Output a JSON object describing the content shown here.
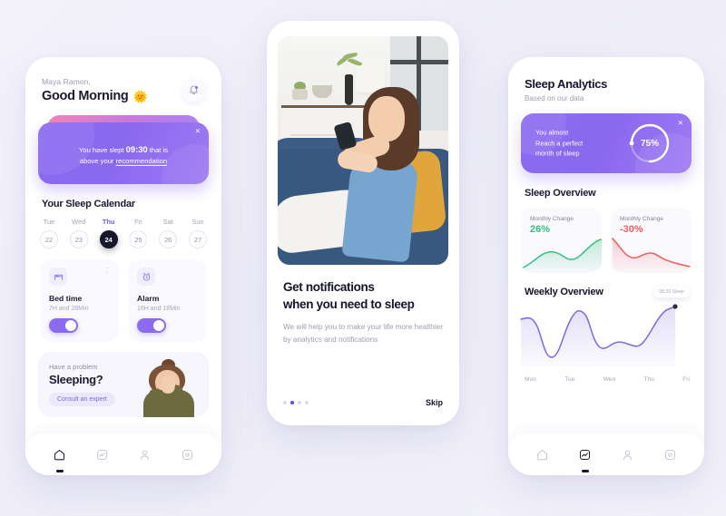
{
  "canvas": {
    "background": "#f1f0fa"
  },
  "phone1": {
    "header": {
      "name": "Maya Ramon,",
      "greeting": "Good Morning",
      "emoji": "🌞",
      "bell_icon": "bell-icon"
    },
    "banner": {
      "close": "✕",
      "prefix": "You have slept ",
      "time": "09:30",
      "middle": " that is",
      "line2_prefix": "above your ",
      "link": "recommendation",
      "gradient_from": "#8d6bf0",
      "gradient_to": "#9d7af3"
    },
    "calendar": {
      "title": "Your Sleep Calendar",
      "days": [
        {
          "day": "Tue",
          "num": "22",
          "active": false
        },
        {
          "day": "Wed",
          "num": "23",
          "active": false
        },
        {
          "day": "Thu",
          "num": "24",
          "active": true
        },
        {
          "day": "Fri",
          "num": "25",
          "active": false
        },
        {
          "day": "Sat",
          "num": "26",
          "active": false
        },
        {
          "day": "Sun",
          "num": "27",
          "active": false
        }
      ]
    },
    "settings": [
      {
        "icon": "bed-icon",
        "name": "Bed time",
        "value": "7H and 28Min",
        "toggle_on": true,
        "menu": "⋮"
      },
      {
        "icon": "alarm-clock-icon",
        "name": "Alarm",
        "value": "16H and 18Min",
        "toggle_on": true,
        "menu": ""
      }
    ],
    "promo": {
      "small": "Have a problem",
      "big": "Sleeping?",
      "button": "Consult an expert"
    },
    "tabs": [
      {
        "icon": "home-icon",
        "active": true
      },
      {
        "icon": "analytics-icon",
        "active": false
      },
      {
        "icon": "profile-icon",
        "active": false
      },
      {
        "icon": "settings-gear-icon",
        "active": false
      }
    ]
  },
  "phone2": {
    "hero_alt": "woman-on-sofa-with-phone-photo",
    "title_line1": "Get notifications",
    "title_line2": "when you need to sleep",
    "subtitle": "We will help you to make your life more healthier by analytics and notifications",
    "dots": [
      false,
      true,
      false,
      false
    ],
    "skip": "Skip"
  },
  "phone3": {
    "title": "Sleep Analytics",
    "subtitle": "Based on our data",
    "analytics_card": {
      "close": "✕",
      "line1": "You almost",
      "line2": "Reach a perfect",
      "line3": "month of sleep",
      "percent": "75%",
      "percent_value": 75
    },
    "overview_title": "Sleep Overview",
    "overview_cards": [
      {
        "label": "Monthly Change",
        "value": "26%",
        "color": "#35c17f",
        "trend": "up"
      },
      {
        "label": "Monthly Change",
        "value": "-30%",
        "color": "#ef5d5d",
        "trend": "down"
      }
    ],
    "weekly": {
      "title": "Weekly Overview",
      "tooltip": "08:20 Sleep",
      "axis": [
        "Mon",
        "Tue",
        "Wed",
        "Thu",
        "Fri"
      ],
      "line_color": "#7b6ae0"
    },
    "tabs": [
      {
        "icon": "home-icon",
        "active": false
      },
      {
        "icon": "analytics-icon",
        "active": true
      },
      {
        "icon": "profile-icon",
        "active": false
      },
      {
        "icon": "settings-gear-icon",
        "active": false
      }
    ]
  },
  "chart_data": [
    {
      "type": "area",
      "title": "Monthly Change",
      "series_name": "positive-trend",
      "color": "#35c17f",
      "label": "26%",
      "x": [
        0,
        1,
        2,
        3,
        4,
        5,
        6,
        7,
        8
      ],
      "values": [
        12,
        22,
        30,
        44,
        40,
        33,
        38,
        52,
        66
      ]
    },
    {
      "type": "area",
      "title": "Monthly Change",
      "series_name": "negative-trend",
      "color": "#ef5d5d",
      "label": "-30%",
      "x": [
        0,
        1,
        2,
        3,
        4,
        5,
        6,
        7,
        8
      ],
      "values": [
        66,
        48,
        33,
        30,
        38,
        36,
        26,
        16,
        11
      ]
    },
    {
      "type": "area",
      "title": "Weekly Overview",
      "categories": [
        "Mon",
        "Tue",
        "Wed",
        "Thu",
        "Fri"
      ],
      "x": [
        0,
        0.5,
        1,
        1.5,
        2,
        2.5,
        3,
        3.5,
        4
      ],
      "values": [
        72,
        68,
        14,
        80,
        30,
        36,
        32,
        44,
        86
      ],
      "ylabel": "",
      "xlabel": "",
      "grid": false,
      "annotation": "08:20 Sleep",
      "color": "#7b6ae0"
    }
  ]
}
